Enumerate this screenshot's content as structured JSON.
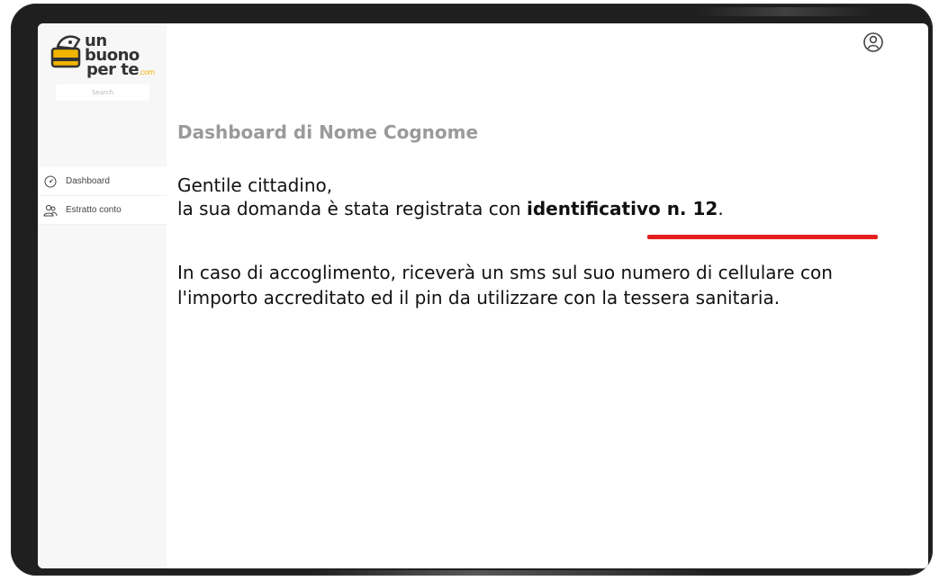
{
  "brand": {
    "line1": "un buono",
    "line2": "per te",
    "domain": ".com",
    "colors": {
      "accent": "#f1b400",
      "dark": "#333333"
    }
  },
  "sidebar": {
    "search_placeholder": "Search",
    "items": [
      {
        "label": "Dashboard",
        "icon": "gauge-icon"
      },
      {
        "label": "Estratto conto",
        "icon": "people-icon"
      }
    ]
  },
  "header": {
    "user_icon": "user-circle-icon"
  },
  "main": {
    "title": "Dashboard di Nome Cognome",
    "greeting": "Gentile cittadino,",
    "registered_prefix": "la sua domanda è stata registrata con ",
    "identifier": "identificativo n. 12",
    "registered_suffix": ".",
    "info": "In caso di accoglimento, riceverà un sms sul suo numero di cellulare con l'importo accreditato ed il pin da utilizzare con la tessera sanitaria.",
    "highlight_color": "#e41d1d"
  }
}
